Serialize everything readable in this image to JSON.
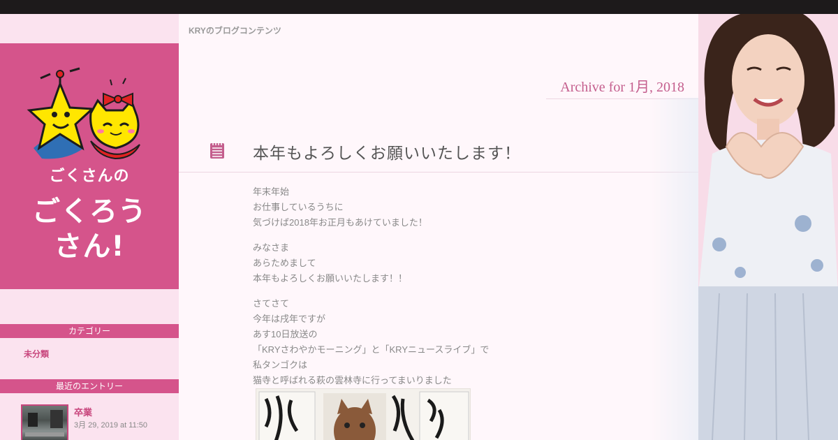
{
  "site": {
    "breadcrumb": "KRYのブログコンテンツ",
    "logo_alt_line1": "ごくさんの",
    "logo_alt_line2": "ごくろう",
    "logo_alt_line3": "さん!"
  },
  "sidebar": {
    "category_heading": "カテゴリー",
    "categories": [
      {
        "label": "未分類"
      }
    ],
    "recent_heading": "最近のエントリー",
    "recent": [
      {
        "title": "卒業",
        "date": "3月 29, 2019 at 11:50"
      }
    ]
  },
  "main": {
    "archive_title": "Archive for 1月, 2018",
    "post": {
      "title": "本年もよろしくお願いいたします！",
      "paragraphs": [
        [
          "年末年始",
          "お仕事しているうちに",
          "気づけば2018年お正月もあけていました！"
        ],
        [
          "みなさま",
          "あらためまして",
          "本年もよろしくお願いいたします！！"
        ],
        [
          "さてさて",
          "今年は戌年ですが",
          "あす10日放送の",
          "「KRYさわやかモーニング」と「KRYニュースライブ」で",
          "私タンゴクは",
          "猫寺と呼ばれる萩の雲林寺に行ってまいりました"
        ]
      ]
    }
  },
  "colors": {
    "topbar": "#1d1a1b",
    "brand_pink": "#d5548b",
    "link_pink": "#c8467d",
    "sidebar_bg": "#fbe3ef",
    "main_bg": "#fff7fb"
  },
  "icons": {
    "post_icon": "notepad-icon"
  }
}
